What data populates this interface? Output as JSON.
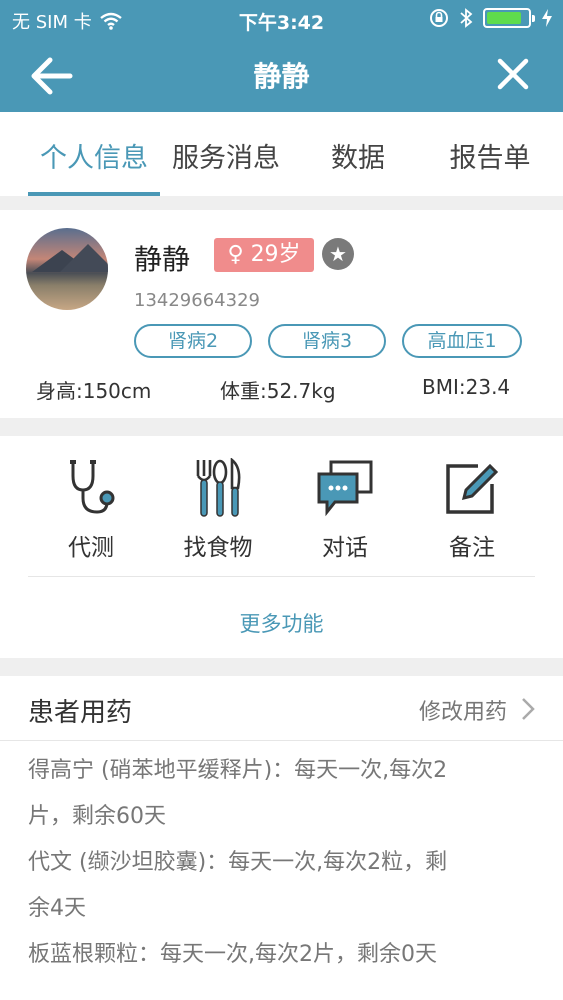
{
  "status_bar": {
    "carrier": "无 SIM 卡",
    "time": "下午3:42",
    "battery_level": 0.85
  },
  "nav": {
    "title": "静静"
  },
  "tabs": [
    {
      "label": "个人信息",
      "active": true
    },
    {
      "label": "服务消息",
      "active": false
    },
    {
      "label": "数据",
      "active": false
    },
    {
      "label": "报告单",
      "active": false
    }
  ],
  "profile": {
    "name": "静静",
    "gender_symbol": "♀",
    "age": "29岁",
    "phone": "13429664329",
    "tags": [
      "肾病2",
      "肾病3",
      "高血压1"
    ],
    "height": "身高:150cm",
    "weight": "体重:52.7kg",
    "bmi": "BMI:23.4"
  },
  "functions": [
    {
      "label": "代测",
      "icon": "stethoscope-icon"
    },
    {
      "label": "找食物",
      "icon": "utensils-icon"
    },
    {
      "label": "对话",
      "icon": "chat-icon"
    },
    {
      "label": "备注",
      "icon": "edit-icon"
    }
  ],
  "more_label": "更多功能",
  "medications": {
    "title": "患者用药",
    "edit_label": "修改用药",
    "items": [
      "得高宁 (硝苯地平缓释片)：每天一次,每次2",
      "片，剩余60天",
      "代文 (缬沙坦胶囊)：每天一次,每次2粒，剩",
      "余4天",
      "板蓝根颗粒：每天一次,每次2片，剩余0天"
    ]
  },
  "colors": {
    "primary": "#4a98b6",
    "badge": "#f08c8c"
  }
}
